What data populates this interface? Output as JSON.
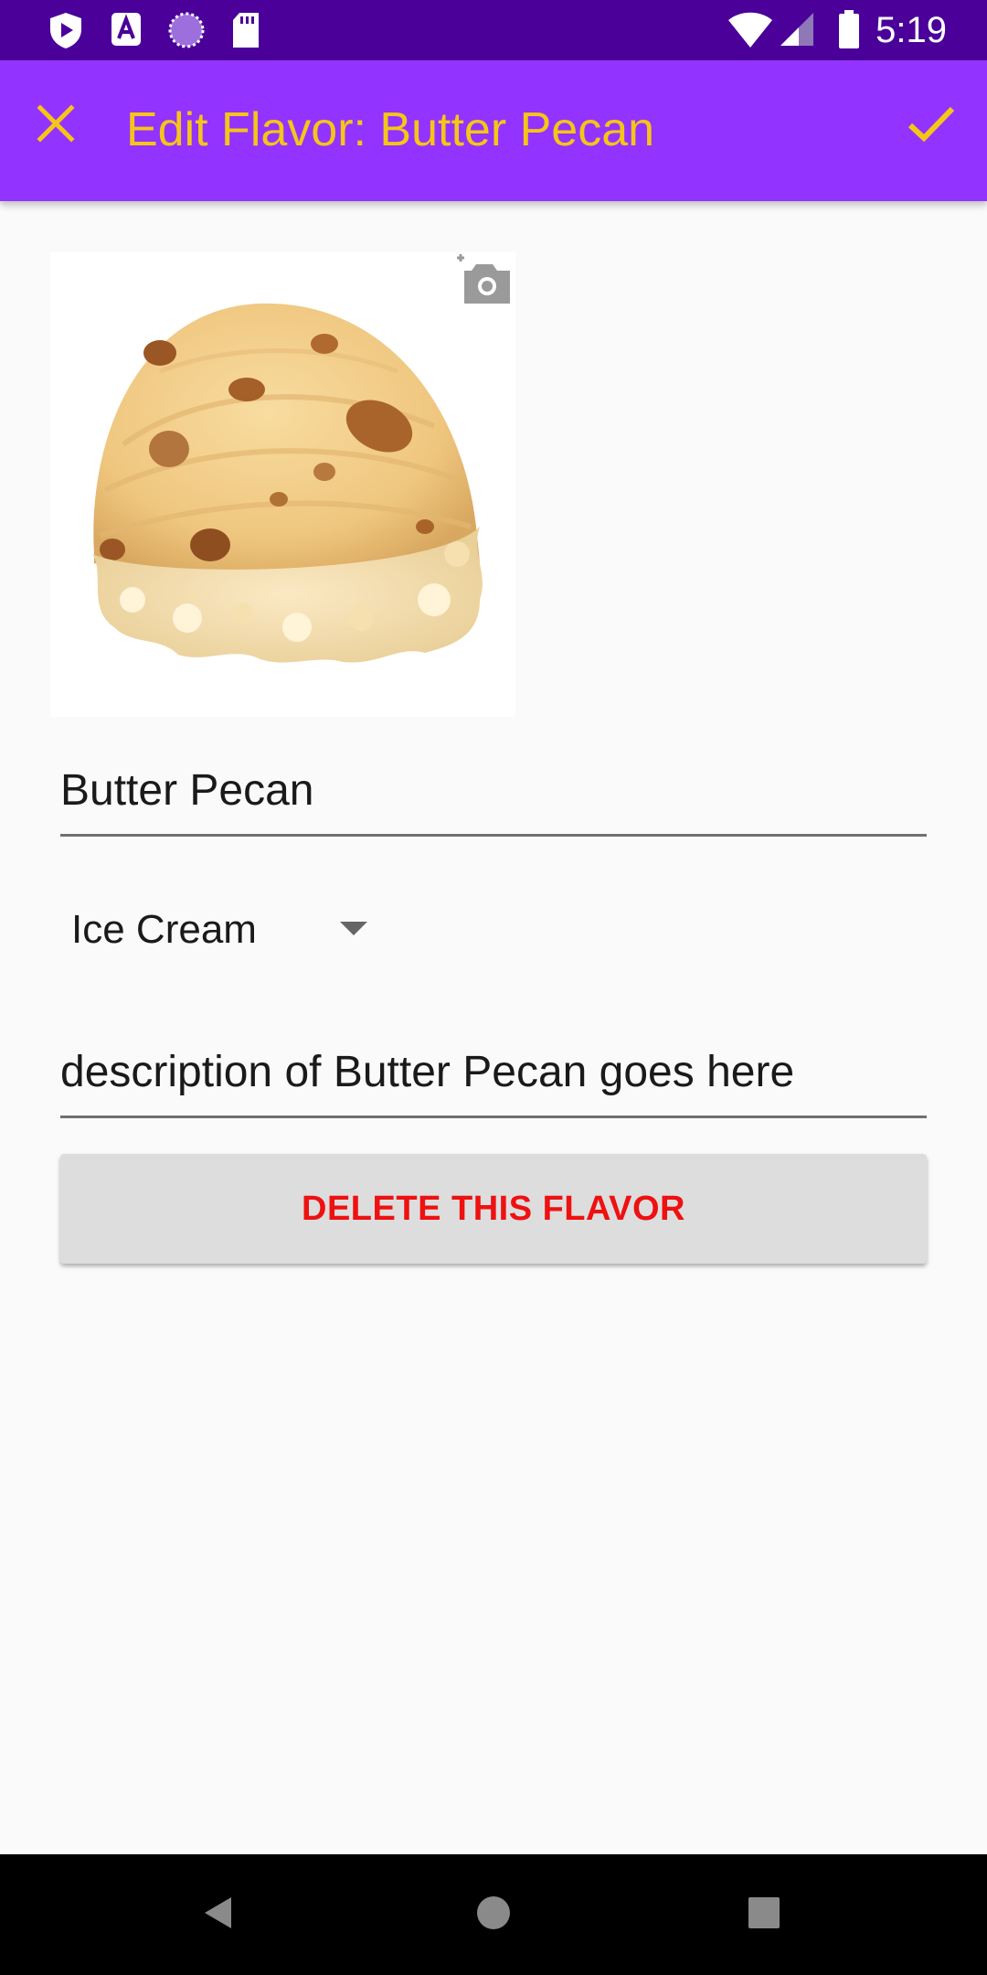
{
  "status_bar": {
    "time": "5:19",
    "left_icons": [
      "shield-play-icon",
      "font-a-icon",
      "sync-circle-icon",
      "sd-card-icon"
    ],
    "right_icons": [
      "wifi-icon",
      "cellular-signal-icon",
      "battery-icon"
    ]
  },
  "app_bar": {
    "title": "Edit Flavor: Butter Pecan",
    "close_icon": "close-icon",
    "confirm_icon": "check-icon",
    "background_color": "#9333ff",
    "title_color": "#f5c518"
  },
  "flavor_image": {
    "subject": "butter pecan ice cream scoop",
    "add_photo_icon": "add-photo-icon"
  },
  "form": {
    "name_value": "Butter Pecan",
    "type_value": "Ice Cream",
    "description_value": "description of Butter Pecan goes here"
  },
  "delete_button": {
    "label": "DELETE THIS FLAVOR",
    "text_color": "#ee1111"
  },
  "nav_bar": {
    "back_icon": "back-triangle-icon",
    "home_icon": "home-circle-icon",
    "recents_icon": "recents-square-icon"
  }
}
